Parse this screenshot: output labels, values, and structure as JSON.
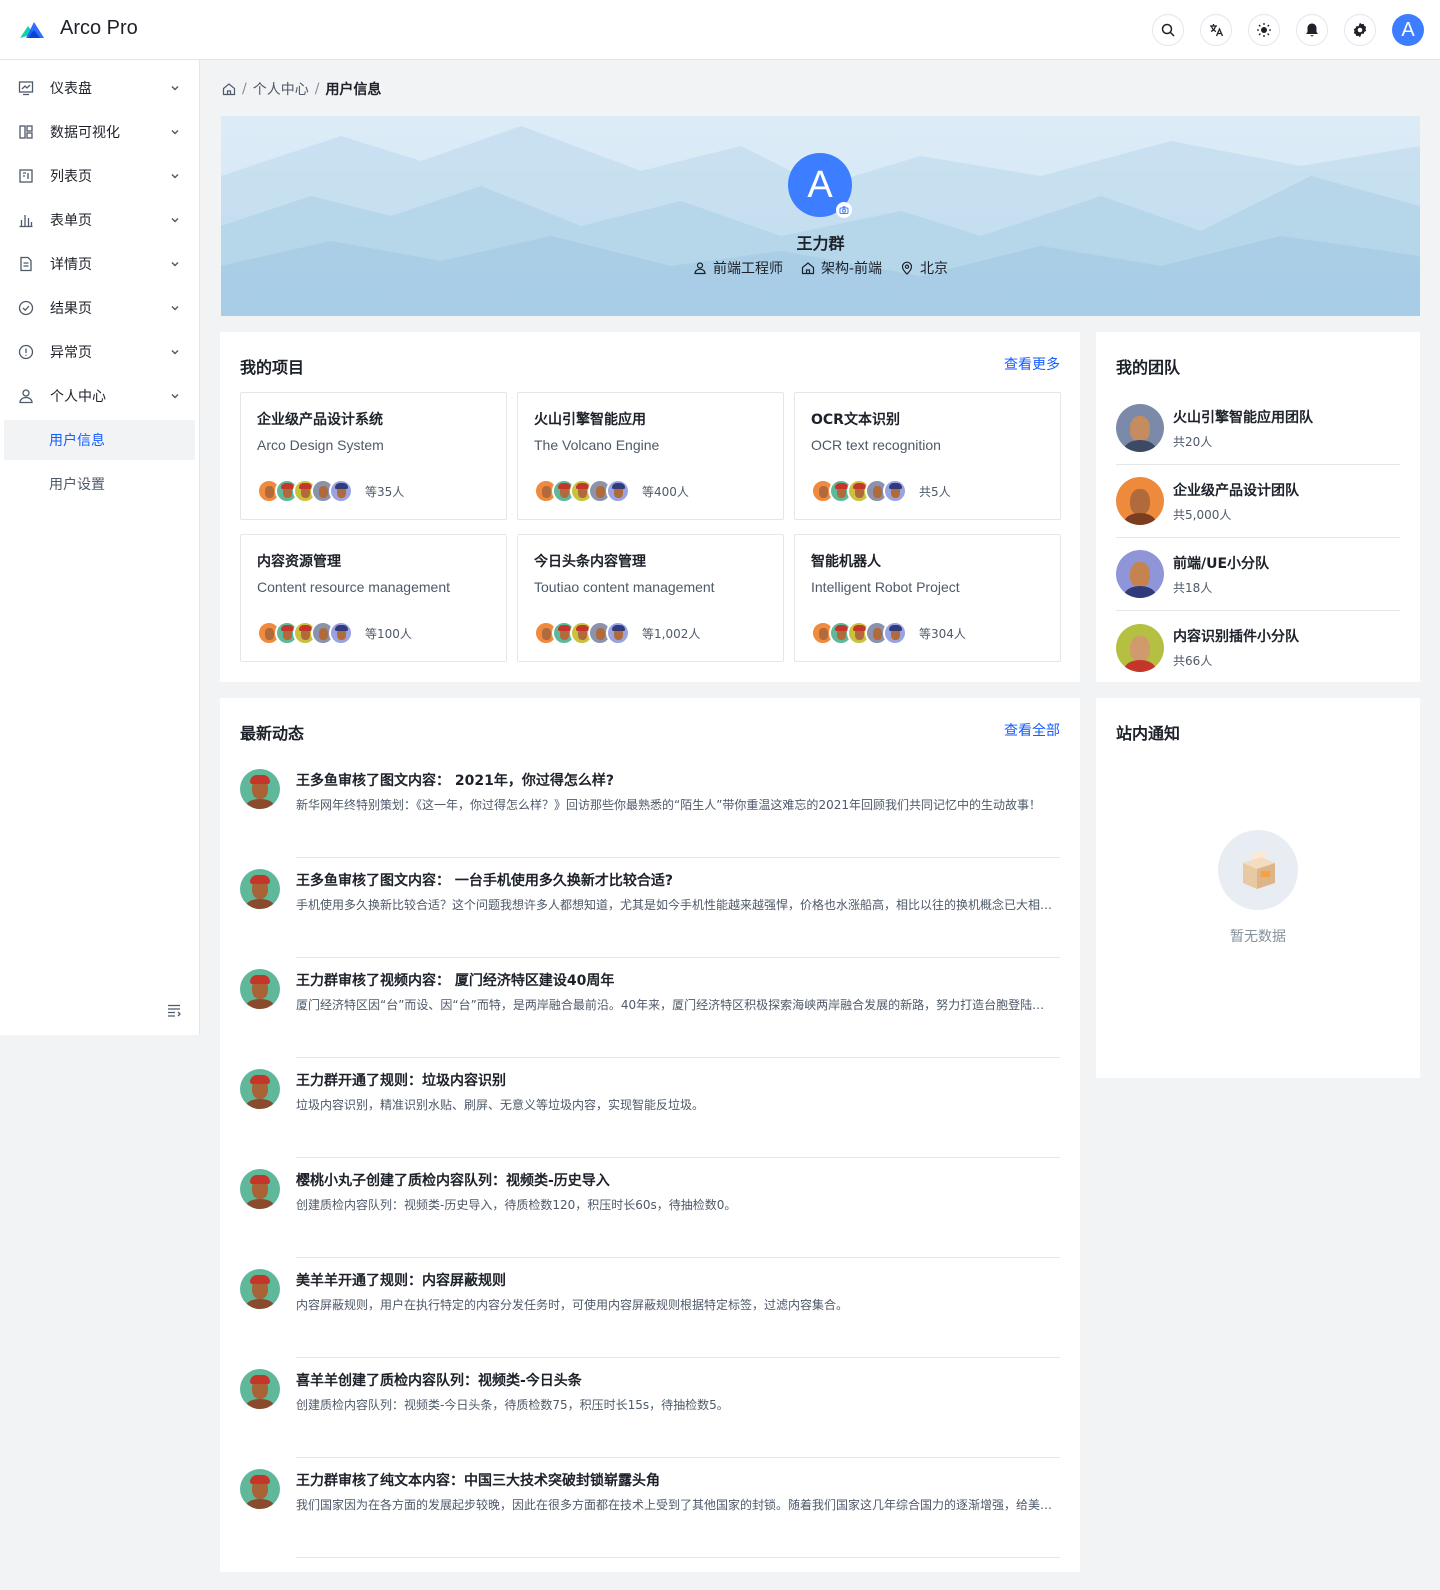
{
  "app": {
    "title": "Arco Pro"
  },
  "colors": {
    "primary": "#165dff",
    "avatar": "#3c7eff",
    "activity_avatar_bg": "#5fb89a"
  },
  "header": {
    "actions": [
      "search-icon",
      "translate-icon",
      "theme-icon",
      "bell-icon",
      "gear-icon"
    ],
    "avatar_letter": "A"
  },
  "sidebar": {
    "items": [
      {
        "label": "仪表盘",
        "icon": "dashboard-icon"
      },
      {
        "label": "数据可视化",
        "icon": "layout-icon"
      },
      {
        "label": "列表页",
        "icon": "list-icon"
      },
      {
        "label": "表单页",
        "icon": "bar-chart-icon"
      },
      {
        "label": "详情页",
        "icon": "file-icon"
      },
      {
        "label": "结果页",
        "icon": "check-circle-icon"
      },
      {
        "label": "异常页",
        "icon": "exclamation-circle-icon"
      },
      {
        "label": "个人中心",
        "icon": "user-icon"
      }
    ],
    "sub_items": [
      {
        "label": "用户信息",
        "active": true
      },
      {
        "label": "用户设置",
        "active": false
      }
    ]
  },
  "breadcrumb": {
    "items": [
      "个人中心",
      "用户信息"
    ]
  },
  "profile": {
    "avatar_letter": "A",
    "name": "王力群",
    "job": "前端工程师",
    "department": "架构-前端",
    "location": "北京"
  },
  "projects": {
    "title": "我的项目",
    "more": "查看更多",
    "items": [
      {
        "name": "企业级产品设计系统",
        "en": "Arco Design System",
        "count": "等35人"
      },
      {
        "name": "火山引擎智能应用",
        "en": "The Volcano Engine",
        "count": "等400人"
      },
      {
        "name": "OCR文本识别",
        "en": "OCR text recognition",
        "count": "共5人"
      },
      {
        "name": "内容资源管理",
        "en": "Content resource management",
        "count": "等100人"
      },
      {
        "name": "今日头条内容管理",
        "en": "Toutiao content management",
        "count": "等1,002人"
      },
      {
        "name": "智能机器人",
        "en": "Intelligent Robot Project",
        "count": "等304人"
      }
    ]
  },
  "teams": {
    "title": "我的团队",
    "items": [
      {
        "name": "火山引擎智能应用团队",
        "count": "共20人",
        "bg": "#7b8aa8"
      },
      {
        "name": "企业级产品设计团队",
        "count": "共5,000人",
        "bg": "#ee8a3c"
      },
      {
        "name": "前端/UE小分队",
        "count": "共18人",
        "bg": "#8e95d8"
      },
      {
        "name": "内容识别插件小分队",
        "count": "共66人",
        "bg": "#b5c043"
      }
    ]
  },
  "activity": {
    "title": "最新动态",
    "more": "查看全部",
    "items": [
      {
        "title": "王多鱼审核了图文内容： 2021年，你过得怎么样?",
        "desc": "新华网年终特别策划：《这一年，你过得怎么样？》回访那些你最熟悉的“陌生人”带你重温这难忘的2021年回顾我们共同记忆中的生动故事！"
      },
      {
        "title": "王多鱼审核了图文内容： 一台手机使用多久换新才比较合适?",
        "desc": "手机使用多久换新比较合适？这个问题我想许多人都想知道，尤其是如今手机性能越来越强悍，价格也水涨船高，相比以往的换机概念已大相径庭。"
      },
      {
        "title": "王力群审核了视频内容： 厦门经济特区建设40周年",
        "desc": "厦门经济特区因“台”而设、因“台”而特，是两岸融合最前沿。40年来，厦门经济特区积极探索海峡两岸融合发展的新路，努力打造台胞登陆的第一家园。"
      },
      {
        "title": "王力群开通了规则：垃圾内容识别",
        "desc": "垃圾内容识别，精准识别水贴、刷屏、无意义等垃圾内容，实现智能反垃圾。"
      },
      {
        "title": "樱桃小丸子创建了质检内容队列：视频类-历史导入",
        "desc": "创建质检内容队列：视频类-历史导入，待质检数120，积压时长60s，待抽检数0。"
      },
      {
        "title": "美羊羊开通了规则：内容屏蔽规则",
        "desc": "内容屏蔽规则，用户在执行特定的内容分发任务时，可使用内容屏蔽规则根据特定标签，过滤内容集合。"
      },
      {
        "title": "喜羊羊创建了质检内容队列：视频类-今日头条",
        "desc": "创建质检内容队列：视频类-今日头条，待质检数75，积压时长15s，待抽检数5。"
      },
      {
        "title": "王力群审核了纯文本内容：中国三大技术突破封锁崭露头角",
        "desc": "我们国家因为在各方面的发展起步较晚，因此在很多方面都在技术上受到了其他国家的封锁。随着我们国家这几年综合国力的逐渐增强，给美国带来的压力也越来越大。"
      }
    ]
  },
  "notice": {
    "title": "站内通知",
    "empty": "暂无数据"
  }
}
